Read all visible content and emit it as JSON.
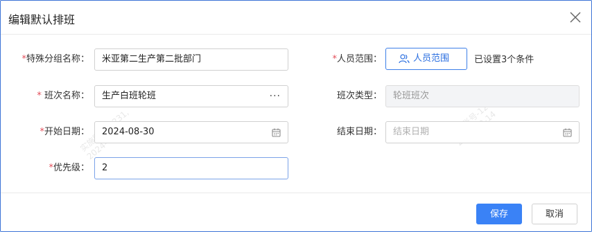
{
  "dialog": {
    "title": "编辑默认排班"
  },
  "form": {
    "group_name": {
      "required": "*",
      "label": "特殊分组名称：",
      "value": "米亚第二生产第二批部门"
    },
    "scope": {
      "required": "*",
      "label": "人员范围：",
      "button_label": "人员范围",
      "info": "已设置3个条件"
    },
    "shift_name": {
      "required": "*",
      "label": " 班次名称：",
      "value": "生产白班轮班",
      "more": "···"
    },
    "shift_type": {
      "label": "班次类型：",
      "value": "轮班班次"
    },
    "start_date": {
      "required": "*",
      "label": "开始日期：",
      "value": "2024-08-30"
    },
    "end_date": {
      "label": "结束日期：",
      "placeholder": "结束日期"
    },
    "priority": {
      "required": "*",
      "label": "优先级：",
      "value": "2"
    }
  },
  "footer": {
    "save_label": "保存",
    "cancel_label": "取消"
  },
  "watermark": {
    "line1": "实施账号-1231,",
    "line2": "2024-09-14"
  },
  "colors": {
    "primary": "#3a82f6",
    "required": "#e34d59",
    "border": "#3b73d6"
  }
}
